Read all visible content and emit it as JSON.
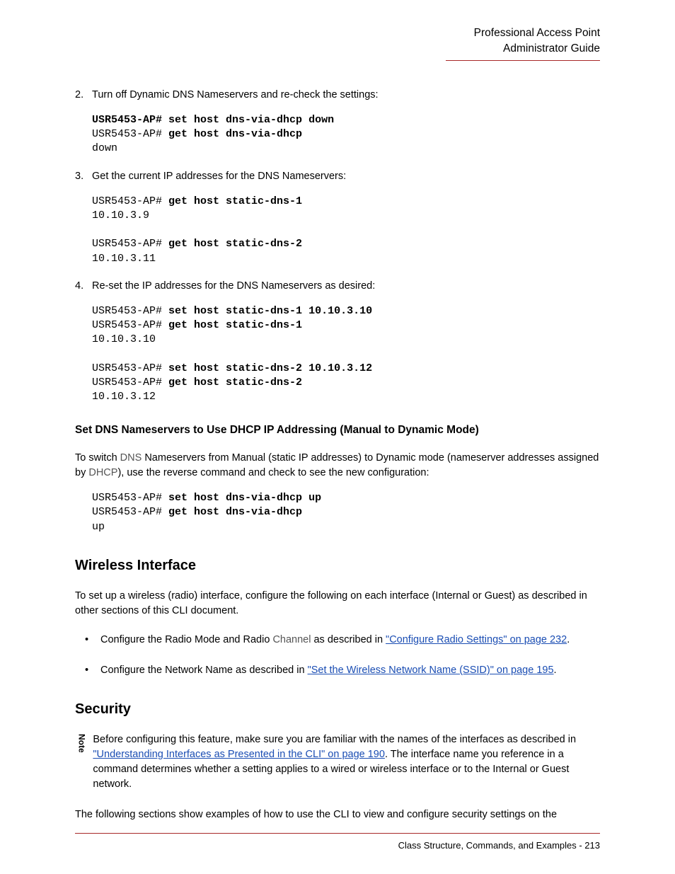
{
  "header": {
    "line1": "Professional Access Point",
    "line2": "Administrator Guide"
  },
  "steps": [
    {
      "num": "2.",
      "text": "Turn off Dynamic DNS Nameservers and re-check the settings:",
      "code": [
        {
          "prompt": "USR5453-AP# ",
          "cmd": "set host dns-via-dhcp down",
          "boldPrompt": true
        },
        {
          "prompt": "USR5453-AP# ",
          "cmd": "get host dns-via-dhcp",
          "boldPrompt": false
        },
        {
          "output": "down"
        }
      ]
    },
    {
      "num": "3.",
      "text": "Get the current IP addresses for the DNS Nameservers:",
      "code": [
        {
          "prompt": "USR5453-AP# ",
          "cmd": "get host static-dns-1"
        },
        {
          "output": "10.10.3.9"
        },
        {
          "blank": true
        },
        {
          "prompt": "USR5453-AP# ",
          "cmd": "get host static-dns-2"
        },
        {
          "output": "10.10.3.11"
        }
      ]
    },
    {
      "num": "4.",
      "text": "Re-set the IP addresses for the DNS Nameservers as desired:",
      "code": [
        {
          "prompt": "USR5453-AP# ",
          "cmd": "set host static-dns-1 10.10.3.10"
        },
        {
          "prompt": "USR5453-AP# ",
          "cmd": "get host static-dns-1"
        },
        {
          "output": "10.10.3.10"
        },
        {
          "blank": true
        },
        {
          "prompt": "USR5453-AP# ",
          "cmd": "set host static-dns-2 10.10.3.12"
        },
        {
          "prompt": "USR5453-AP# ",
          "cmd": "get host static-dns-2"
        },
        {
          "output": "10.10.3.12"
        }
      ]
    }
  ],
  "sectionHeading": "Set DNS Nameservers to Use DHCP IP Addressing (Manual to Dynamic Mode)",
  "sectionPara": {
    "pre": "To switch ",
    "dns": "DNS",
    "mid": " Nameservers from Manual (static IP addresses) to Dynamic mode (nameserver addresses assigned by ",
    "dhcp": "DHCP",
    "post": "), use the reverse command and check to see the new configuration:"
  },
  "sectionCode": [
    {
      "prompt": "USR5453-AP# ",
      "cmd": "set host dns-via-dhcp up"
    },
    {
      "prompt": "USR5453-AP# ",
      "cmd": "get host dns-via-dhcp"
    },
    {
      "output": "up"
    }
  ],
  "wirelessHeading": "Wireless Interface",
  "wirelessPara": "To set up a wireless (radio) interface, configure the following on each interface (Internal or Guest) as described in other sections of this CLI document.",
  "wirelessBullets": [
    {
      "pre": "Configure the Radio Mode and Radio ",
      "glossary": "Channel",
      "mid": " as described in ",
      "link": "\"Configure Radio Settings\" on page 232",
      "post": "."
    },
    {
      "pre": "Configure the Network Name as described in ",
      "link": "\"Set the Wireless Network Name (SSID)\" on page 195",
      "post": "."
    }
  ],
  "securityHeading": "Security",
  "note": {
    "label": "Note",
    "pre": "Before configuring this feature, make sure you are familiar with the names of the interfaces as described in ",
    "link": "\"Understanding Interfaces as Presented in the CLI\" on page 190",
    "post": ". The interface name you reference in a command determines whether a setting applies to a wired or wireless interface or to the Internal or Guest network."
  },
  "securityPara": "The following sections show examples of how to use the CLI to view and configure security settings on the",
  "footer": "Class Structure, Commands, and Examples - 213"
}
